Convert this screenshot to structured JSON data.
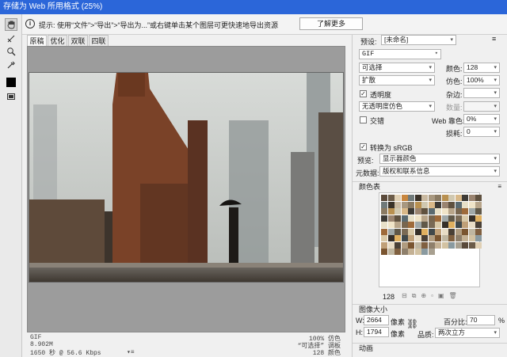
{
  "window": {
    "title": "存储为 Web 所用格式 (25%)"
  },
  "info": {
    "text": "提示: 使用“文件”>“导出”>“导出为...”或右键单击某个图层可更快速地导出资源",
    "learn_more": "了解更多"
  },
  "view_tabs": [
    "原稿",
    "优化",
    "双联",
    "四联"
  ],
  "status": {
    "left": [
      "GIF",
      "8.902M",
      "1650 秒 @ 56.6 Kbps"
    ],
    "right": [
      "100% 仿色",
      "“可选择” 调板",
      "128 颜色"
    ]
  },
  "preset": {
    "label": "预设:",
    "value": "[未命名]"
  },
  "format": {
    "value": "GIF"
  },
  "reduction": {
    "value": "可选择"
  },
  "dither_algo": {
    "value": "扩散"
  },
  "colors": {
    "label": "颜色:",
    "value": "128"
  },
  "dither": {
    "label": "仿色:",
    "value": "100%"
  },
  "transparency": {
    "label": "透明度",
    "checked": true
  },
  "matte": {
    "label": "杂边:"
  },
  "trans_dither": {
    "value": "无透明度仿色"
  },
  "amount": {
    "label": "数量:"
  },
  "interlaced": {
    "label": "交错",
    "checked": false
  },
  "web_snap": {
    "label": "Web 靠色:",
    "value": "0%"
  },
  "lossy": {
    "label": "损耗:",
    "value": "0"
  },
  "convert_srgb": {
    "label": "转换为 sRGB",
    "checked": true
  },
  "preview": {
    "label": "预览:",
    "value": "显示器颜色"
  },
  "metadata": {
    "label": "元数据:",
    "value": "版权和联系信息"
  },
  "color_table": {
    "label": "颜色表",
    "count": "128"
  },
  "image_size": {
    "label": "图像大小",
    "w_label": "W:",
    "w_value": "2664",
    "w_unit": "像素",
    "h_label": "H:",
    "h_value": "1794",
    "h_unit": "像素",
    "percent_label": "百分比:",
    "percent_value": "70",
    "percent_unit": "%",
    "quality_label": "品质:",
    "quality_value": "两次立方"
  },
  "animation": {
    "label": "动画"
  },
  "colors_theme": {
    "titlebar": "#2b66d9",
    "palette": [
      "#5a4a3a",
      "#7a6a55",
      "#c9b9a0",
      "#e8dcc5",
      "#3d3a35",
      "#8e7f6b",
      "#b8a58a",
      "#6b5b48",
      "#d9c9a8",
      "#a89880",
      "#4a4036",
      "#9a8470",
      "#c4b194",
      "#78664f",
      "#e0d0b4",
      "#362f28",
      "#8a7a62",
      "#b09c80",
      "#5f513f",
      "#d2c2a2",
      "#9e6a3a",
      "#c8863e",
      "#e0b060",
      "#b89050",
      "#7a5530",
      "#5a6a70",
      "#8a9aa0",
      "#a0a8a8",
      "#707a7a",
      "#40484a",
      "#d0c8b0",
      "#bfb6a0",
      "#e8e0c8",
      "#a8a090",
      "#605848",
      "#3a3228",
      "#c0a078",
      "#d8b888",
      "#806040",
      "#f0e4c8"
    ]
  }
}
